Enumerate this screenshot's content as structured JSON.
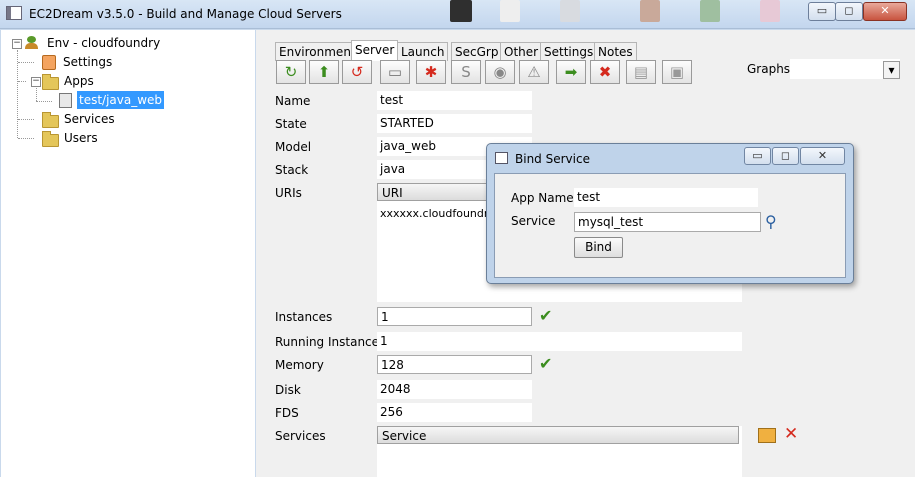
{
  "window": {
    "title": "EC2Dream v3.5.0 - Build and Manage Cloud Servers",
    "min_glyph": "▭",
    "max_glyph": "◻",
    "close_glyph": "✕"
  },
  "tree": {
    "root": "Env - cloudfoundry",
    "settings": "Settings",
    "apps": "Apps",
    "app_selected": "test/java_web",
    "services": "Services",
    "users": "Users",
    "collapse_glyph": "−"
  },
  "tabs": [
    "Environment",
    "Server",
    "Launch",
    "SecGrp",
    "Other",
    "Settings",
    "Notes"
  ],
  "toolbar": [
    "refresh-icon",
    "upload-icon",
    "restart-icon",
    "console-icon",
    "debug-icon",
    "files-icon",
    "instances-icon",
    "crash-icon",
    "start-icon",
    "stop-icon",
    "logs-icon",
    "stats-icon"
  ],
  "toolbar_glyphs": [
    "↻",
    "⬆",
    "↺",
    "▭",
    "✱",
    "S",
    "◉",
    "⚠",
    "➡",
    "✖",
    "▤",
    "▣"
  ],
  "graphs": {
    "label": "Graphs",
    "value": "",
    "dropdown_glyph": "▾"
  },
  "form": {
    "name_label": "Name",
    "name_value": "test",
    "state_label": "State",
    "state_value": "STARTED",
    "model_label": "Model",
    "model_value": "java_web",
    "stack_label": "Stack",
    "stack_value": "java",
    "uris_label": "URIs",
    "uri_header": "URI",
    "uri_value": "xxxxxx.cloudfoundry",
    "instances_label": "Instances",
    "instances_value": "1",
    "running_label": "Running Instances",
    "running_value": "1",
    "memory_label": "Memory",
    "memory_value": "128",
    "disk_label": "Disk",
    "disk_value": "2048",
    "fds_label": "FDS",
    "fds_value": "256",
    "services_label": "Services",
    "services_header": "Service"
  },
  "glyphs": {
    "check": "✔",
    "delete": "✕",
    "search": "⚲"
  },
  "dialog": {
    "title": "Bind Service",
    "app_name_label": "App Name",
    "app_name_value": "test",
    "service_label": "Service",
    "service_value": "mysql_test",
    "bind_label": "Bind"
  },
  "colors": {
    "selection": "#3399ff",
    "check": "#3c8d1f",
    "delete": "#d52a1e"
  }
}
